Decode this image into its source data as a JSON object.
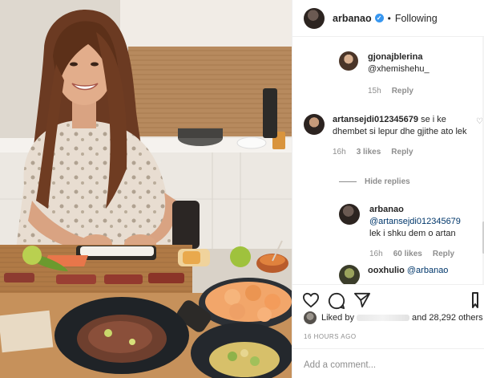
{
  "header": {
    "username": "arbanao",
    "separator": "•",
    "follow_status": "Following",
    "verified_symbol": "✓"
  },
  "comments": [
    {
      "username": "gjonajblerina",
      "text": "@xhemishehu_ ⁣ ⁣ ⁣",
      "time": "15h",
      "reply_label": "Reply"
    },
    {
      "username": "artansejdi012345679",
      "text": "se i ke dhembet si lepur dhe gjithe ato lek",
      "time": "16h",
      "likes": "3 likes",
      "reply_label": "Reply",
      "hide_replies_label": "Hide replies"
    },
    {
      "username": "arbanao",
      "mention": "@artansejdi012345679",
      "text": "lek i shku dem o artan",
      "time": "16h",
      "likes": "60 likes",
      "reply_label": "Reply"
    },
    {
      "username": "ooxhulio",
      "text": "@arbanao"
    }
  ],
  "likes": {
    "prefix": "Liked by",
    "suffix": "and 28,292 others"
  },
  "time_ago": "16 HOURS AGO",
  "add_comment": {
    "placeholder": "Add a comment..."
  },
  "icons": [
    "heart-icon",
    "comment-icon",
    "share-icon",
    "bookmark-icon",
    "verified-badge-icon"
  ],
  "colors": {
    "verified": "#3897f0",
    "muted": "#8e8e8e",
    "text": "#262626"
  }
}
